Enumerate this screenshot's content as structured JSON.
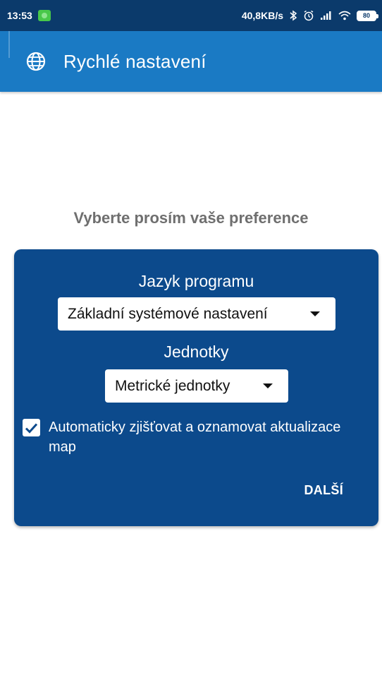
{
  "status_bar": {
    "time": "13:53",
    "network_speed": "40,8KB/s",
    "battery": "80",
    "icons": [
      "android-notification-icon",
      "bluetooth-icon",
      "alarm-icon",
      "signal-icon",
      "wifi-icon",
      "battery-icon"
    ]
  },
  "app_bar": {
    "title": "Rychlé nastavení",
    "icon": "globe-icon"
  },
  "prompt": "Vyberte prosím vaše preference",
  "settings": {
    "language_label": "Jazyk programu",
    "language_value": "Základní systémové nastavení",
    "units_label": "Jednotky",
    "units_value": "Metrické jednotky",
    "auto_update_checked": true,
    "auto_update_label": "Automaticky zjišťovat a oznamovat aktualizace map",
    "next_label": "DALŠÍ"
  },
  "colors": {
    "status_bar": "#0b3a6b",
    "app_bar": "#1a7ac4",
    "card": "#0c4a8c",
    "prompt_text": "#6f6f6f"
  }
}
